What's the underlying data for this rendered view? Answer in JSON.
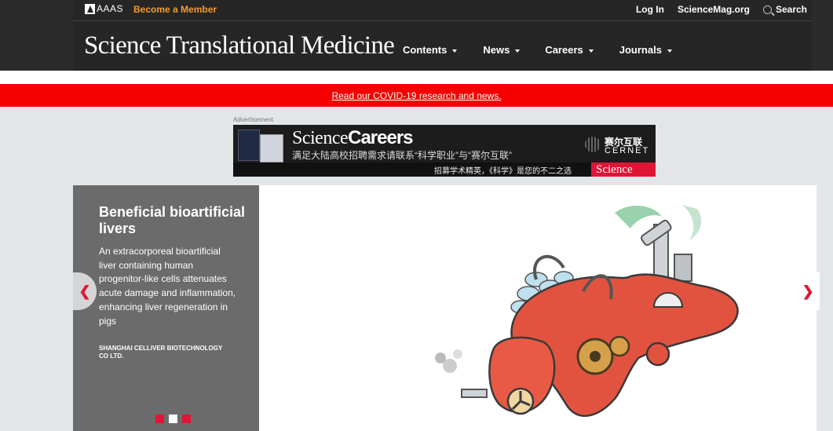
{
  "util": {
    "aaas": "AAAS",
    "become": "Become a Member",
    "login": "Log In",
    "sciencemag": "ScienceMag.org",
    "search": "Search"
  },
  "brand": "Science Translational Medicine",
  "nav": [
    {
      "label": "Contents"
    },
    {
      "label": "News"
    },
    {
      "label": "Careers"
    },
    {
      "label": "Journals"
    }
  ],
  "covid": "Read our COVID-19 research and news.",
  "ad": {
    "label": "Advertisement",
    "science": "Science",
    "careers": "Careers",
    "line1": "满足大陆高校招聘需求请联系“科学职业”与“赛尔互联”",
    "cernet_cn": "赛尔互联",
    "cernet": "CERNET",
    "line2": "招募学术精英，《科学》是您的不二之选",
    "science_tag": "Science"
  },
  "hero": {
    "title": "Beneficial bioartificial livers",
    "desc": "An extracorporeal bioartificial liver containing human progenitor-like cells attenuates acute damage and inflammation, enhancing liver regeneration in pigs",
    "credit": "SHANGHAI CELLIVER BIOTECHNOLOGY CO LTD.",
    "slides": 3,
    "active_slide": 2
  },
  "colors": {
    "accent": "#e01536",
    "banner": "#f40000",
    "become": "#f39c2a",
    "header": "#262626"
  }
}
